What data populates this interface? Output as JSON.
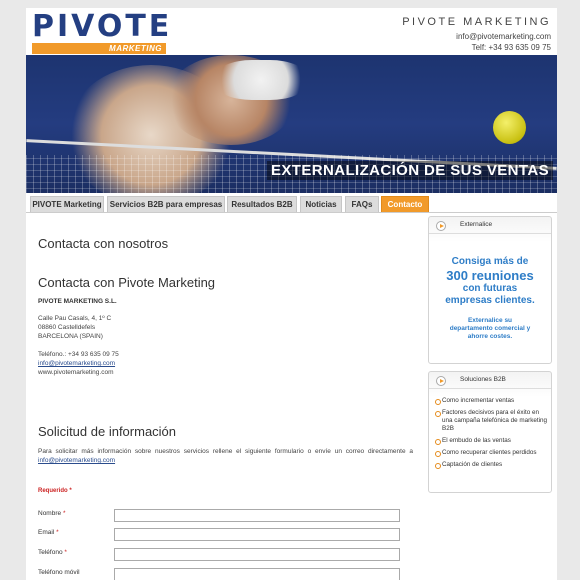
{
  "header": {
    "logo_text": "PIVOTE",
    "logo_subtitle": "MARKETING",
    "brand_name": "PIVOTE MARKETING",
    "email": "info@pivotemarketing.com",
    "phone": "Telf: +34 93 635 09 75"
  },
  "hero": {
    "slogan": "EXTERNALIZACIÓN DE SUS VENTAS"
  },
  "nav": {
    "tabs": [
      {
        "label": "PIVOTE Marketing",
        "active": false
      },
      {
        "label": "Servicios B2B para empresas",
        "active": false
      },
      {
        "label": "Resultados B2B",
        "active": false
      },
      {
        "label": "Noticias",
        "active": false
      },
      {
        "label": "FAQs",
        "active": false
      },
      {
        "label": "Contacto",
        "active": true
      }
    ]
  },
  "main": {
    "page_title": "Contacta con nosotros",
    "contact_heading": "Contacta con Pivote Marketing",
    "company": "PIVOTE MARKETING S.L.",
    "address": [
      "Calle Pau Casals, 4, 1º C",
      "08860 Castelldefels",
      "BARCELONA (SPAIN)"
    ],
    "phone": "Teléfono.: +34 93 635 09 75",
    "email": "info@pivotemarketing.com",
    "website": "www.pivotemarketing.com",
    "info_heading": "Solicitud de información",
    "info_text": "Para solicitar más información sobre nuestros servicios rellene el siguiente formulario o envíe un correo directamente a",
    "info_email": "info@pivotemarketing.com",
    "required_note": "Requerido *",
    "form_fields": [
      {
        "label": "Nombre",
        "required": true,
        "value": ""
      },
      {
        "label": "Email",
        "required": true,
        "value": ""
      },
      {
        "label": "Teléfono",
        "required": true,
        "value": ""
      },
      {
        "label": "Teléfono móvil",
        "required": false,
        "value": ""
      }
    ]
  },
  "sidebar": {
    "promo_box": {
      "title": "Externalice",
      "line1": "Consiga más de",
      "line2": "300 reuniones",
      "line3": "con futuras",
      "line4": "empresas clientes.",
      "sub1": "Externalice su",
      "sub2": "departamento comercial y",
      "sub3": "ahorre costes."
    },
    "solutions_box": {
      "title": "Soluciones B2B",
      "items": [
        "Como incrementar ventas",
        "Factores decisivos para el éxito en una campaña telefónica de marketing B2B",
        "El embudo de las ventas",
        "Como recuperar clientes perdidos",
        "Captación de clientes"
      ]
    }
  },
  "colors": {
    "accent": "#f19a2a",
    "brand_blue": "#243f82",
    "promo_blue": "#2e7dc7"
  }
}
